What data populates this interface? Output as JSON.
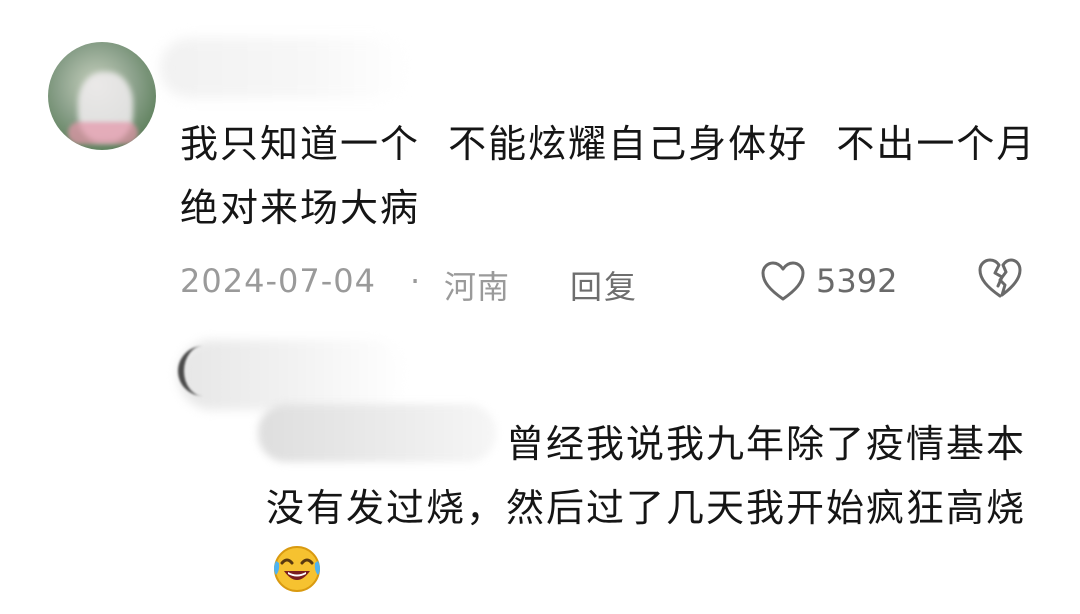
{
  "comment": {
    "text": "我只知道一个  不能炫耀自己身体好  不出一个月绝对来场大病",
    "date": "2024-07-04",
    "separator": "·",
    "location": "河南",
    "reply_label": "回复",
    "like_count": "5392",
    "like_icon": "heart-outline-icon",
    "dislike_icon": "broken-heart-icon"
  },
  "reply": {
    "text": "曾经我说我九年除了疫情基本没有发过烧，然后过了几天我开始疯狂高烧",
    "emoji": "laughing-crying-emoji-icon"
  },
  "colors": {
    "text": "#151515",
    "meta": "#9a9a9a",
    "icon": "#6a6a6a"
  }
}
